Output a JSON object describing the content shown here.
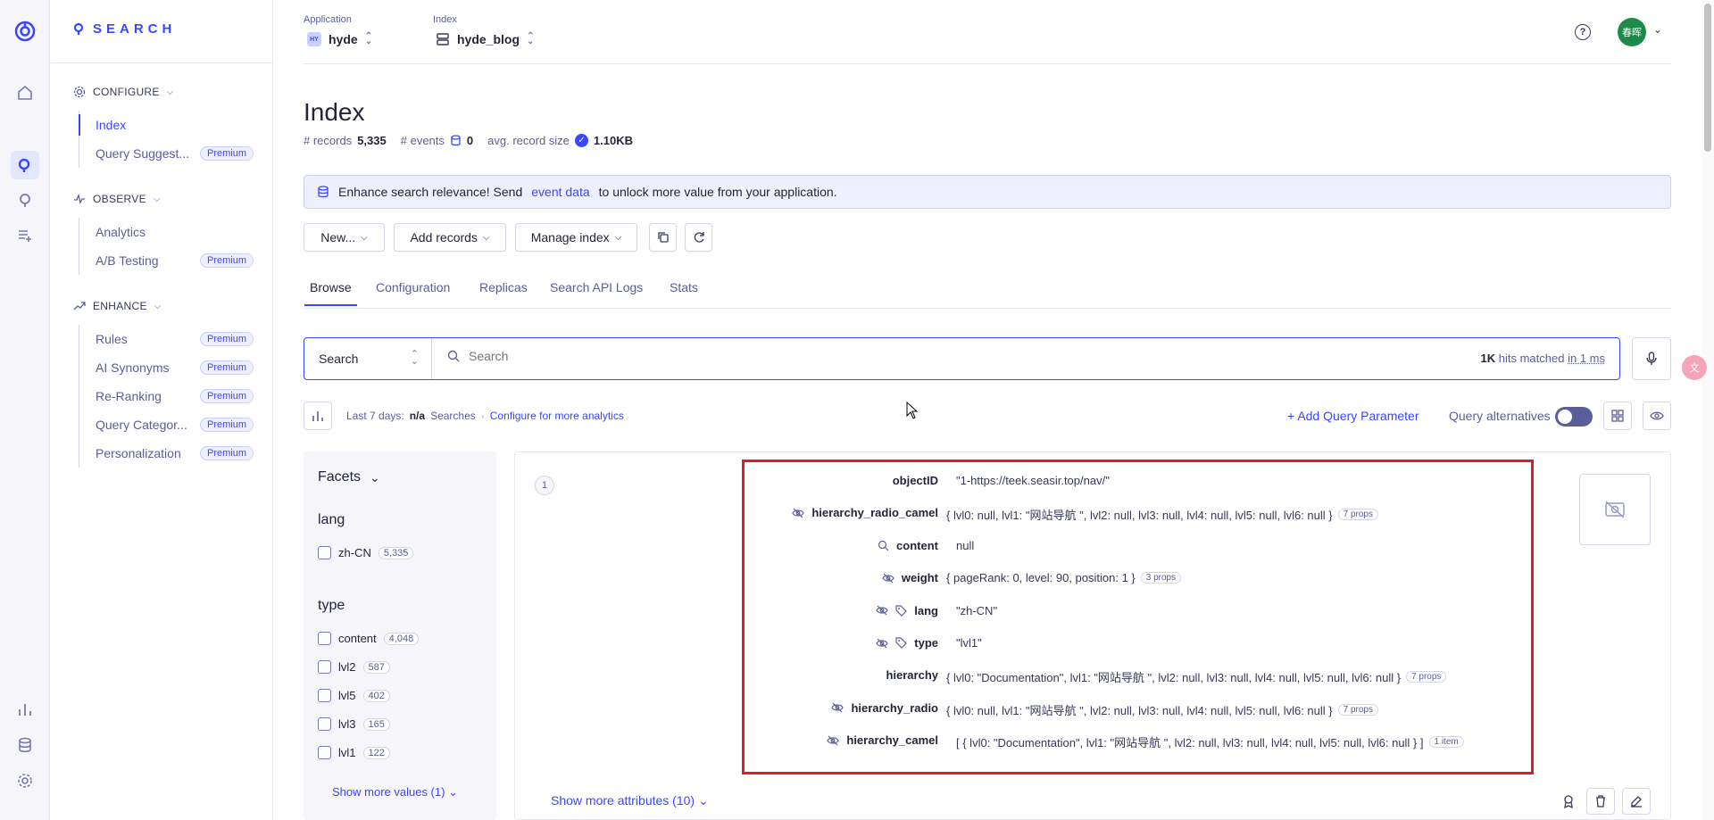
{
  "brand": {
    "name": "SEARCH"
  },
  "sidebar": {
    "configure": {
      "label": "CONFIGURE",
      "items": [
        {
          "label": "Index",
          "active": true,
          "badge": ""
        },
        {
          "label": "Query Suggest...",
          "badge": "Premium"
        }
      ]
    },
    "observe": {
      "label": "OBSERVE",
      "items": [
        {
          "label": "Analytics",
          "badge": ""
        },
        {
          "label": "A/B Testing",
          "badge": "Premium"
        }
      ]
    },
    "enhance": {
      "label": "ENHANCE",
      "items": [
        {
          "label": "Rules",
          "badge": "Premium"
        },
        {
          "label": "AI Synonyms",
          "badge": "Premium"
        },
        {
          "label": "Re-Ranking",
          "badge": "Premium"
        },
        {
          "label": "Query Categor...",
          "badge": "Premium"
        },
        {
          "label": "Personalization",
          "badge": "Premium"
        }
      ]
    }
  },
  "topbar": {
    "application_label": "Application",
    "application_value": "hyde",
    "application_icon_text": "HY",
    "index_label": "Index",
    "index_value": "hyde_blog",
    "avatar_text": "春晖"
  },
  "page": {
    "title": "Index",
    "records_label": "# records",
    "records_value": "5,335",
    "events_label": "# events",
    "events_value": "0",
    "avg_label": "avg. record size",
    "avg_value": "1.10KB"
  },
  "banner": {
    "text_before": "Enhance search relevance! Send",
    "link": "event data",
    "text_after": "to unlock more value from your application."
  },
  "toolbar": {
    "new_label": "New...",
    "add_records_label": "Add records",
    "manage_index_label": "Manage index"
  },
  "tabs": [
    "Browse",
    "Configuration",
    "Replicas",
    "Search API Logs",
    "Stats"
  ],
  "search": {
    "type_label": "Search",
    "placeholder": "Search",
    "hits_count": "1K",
    "hits_text": "hits matched",
    "time_text": "in 1 ms"
  },
  "analytics": {
    "period": "Last 7 days:",
    "searches_value": "n/a",
    "searches_label": "Searches",
    "configure_link": "Configure for more analytics",
    "add_query_param": "Add Query Parameter",
    "query_alternatives": "Query alternatives"
  },
  "facets": {
    "header": "Facets",
    "lang": {
      "title": "lang",
      "items": [
        {
          "label": "zh-CN",
          "count": "5,335"
        }
      ]
    },
    "type": {
      "title": "type",
      "items": [
        {
          "label": "content",
          "count": "4,048"
        },
        {
          "label": "lvl2",
          "count": "587"
        },
        {
          "label": "lvl5",
          "count": "402"
        },
        {
          "label": "lvl3",
          "count": "165"
        },
        {
          "label": "lvl1",
          "count": "122"
        }
      ]
    },
    "show_more": "Show more values (1)"
  },
  "hit": {
    "number": "1",
    "attributes": [
      {
        "name": "objectID",
        "value": "\"1-https://teek.seasir.top/nav/\"",
        "props": "",
        "icons": []
      },
      {
        "name": "hierarchy_radio_camel",
        "value": "{ lvl0: null, lvl1: \"网站导航 \", lvl2: null, lvl3: null, lvl4: null, lvl5: null, lvl6: null }",
        "props": "7 props",
        "icons": [
          "eye-off"
        ]
      },
      {
        "name": "content",
        "value": "null",
        "props": "",
        "icons": [
          "search"
        ]
      },
      {
        "name": "weight",
        "value": "{ pageRank: 0, level: 90, position: 1 }",
        "props": "3 props",
        "icons": [
          "eye-off"
        ]
      },
      {
        "name": "lang",
        "value": "\"zh-CN\"",
        "props": "",
        "icons": [
          "eye-off",
          "tag"
        ]
      },
      {
        "name": "type",
        "value": "\"lvl1\"",
        "props": "",
        "icons": [
          "eye-off",
          "tag"
        ]
      },
      {
        "name": "hierarchy",
        "value": "{ lvl0: \"Documentation\", lvl1: \"网站导航 \", lvl2: null, lvl3: null, lvl4: null, lvl5: null, lvl6: null }",
        "props": "7 props",
        "icons": []
      },
      {
        "name": "hierarchy_radio",
        "value": "{ lvl0: null, lvl1: \"网站导航 \", lvl2: null, lvl3: null, lvl4: null, lvl5: null, lvl6: null }",
        "props": "7 props",
        "icons": [
          "eye-off"
        ]
      },
      {
        "name": "hierarchy_camel",
        "value": "[ { lvl0: \"Documentation\", lvl1: \"网站导航 \", lvl2: null, lvl3: null, lvl4: null, lvl5: null, lvl6: null } ]",
        "props": "1 item",
        "icons": [
          "eye-off"
        ]
      }
    ],
    "show_more_attributes": "Show more attributes (10)"
  },
  "colors": {
    "accent": "#3a46ff",
    "highlight": "#e01b24"
  }
}
